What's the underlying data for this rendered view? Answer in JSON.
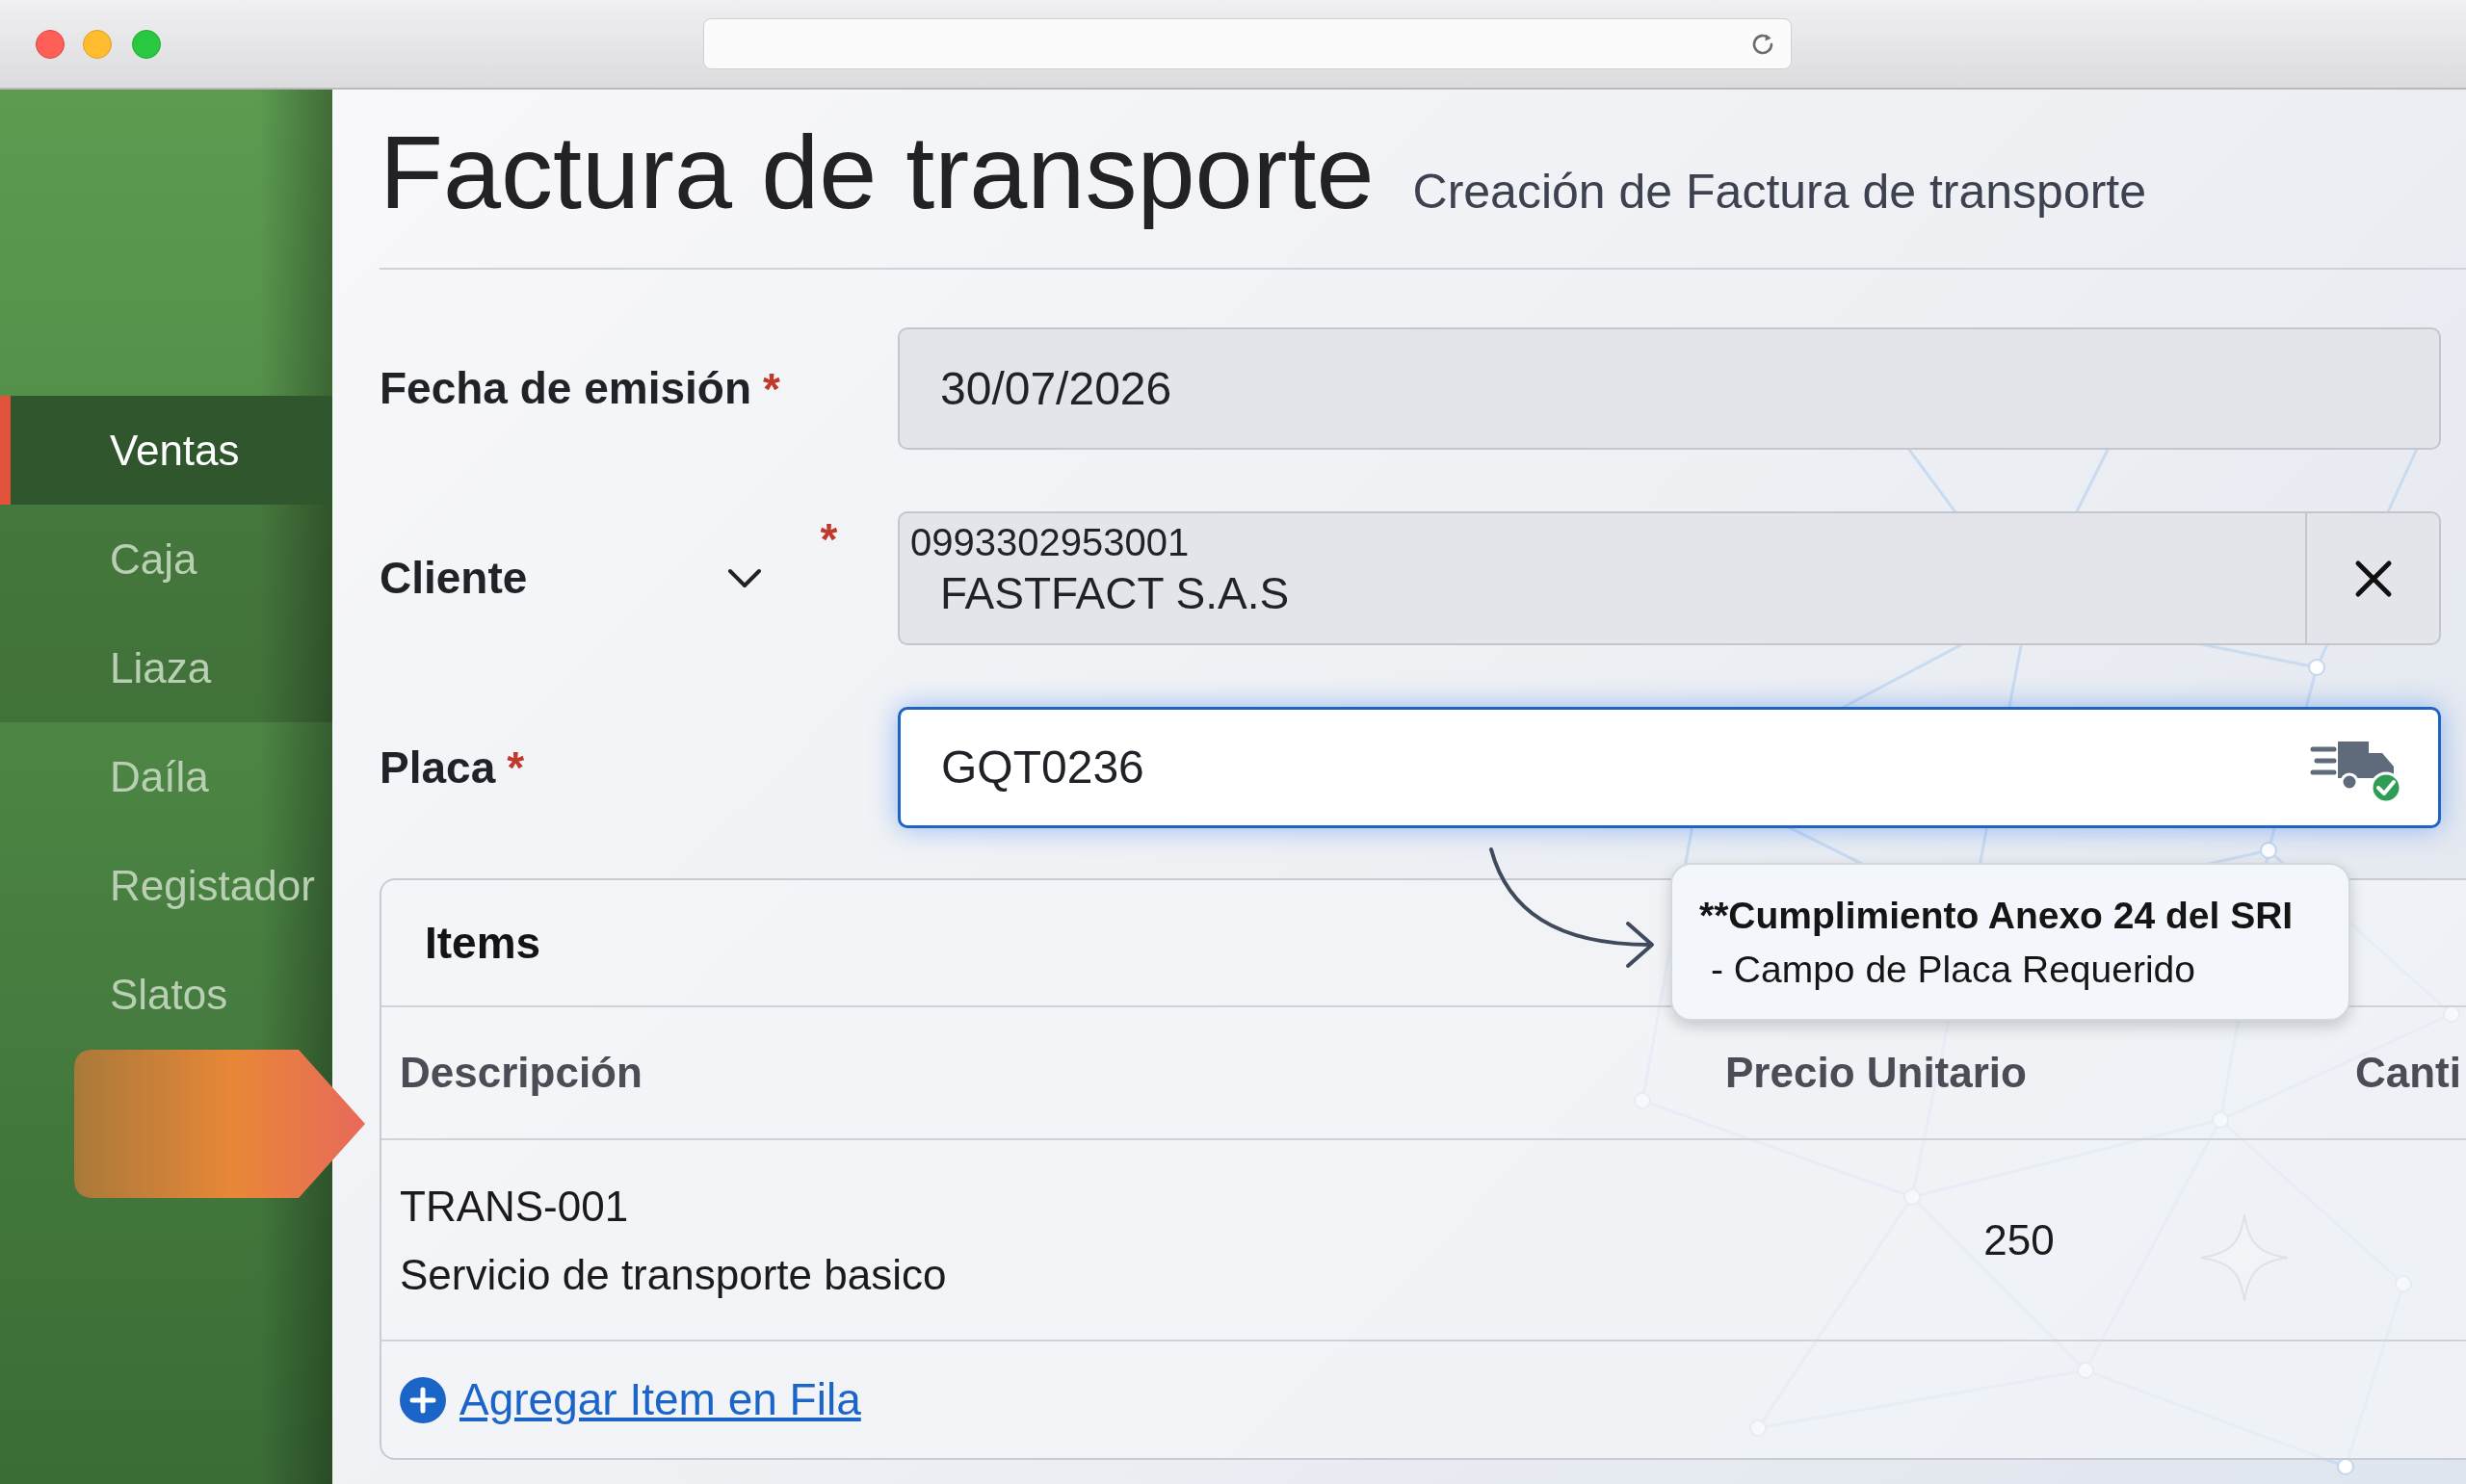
{
  "sidebar": {
    "items": [
      {
        "label": "Ventas",
        "selected": true,
        "highlighted": false
      },
      {
        "label": "Caja",
        "selected": false,
        "highlighted": true
      },
      {
        "label": "Liaza",
        "selected": false,
        "highlighted": true
      },
      {
        "label": "Daíla",
        "selected": false,
        "highlighted": false
      },
      {
        "label": "Registador",
        "selected": false,
        "highlighted": false
      },
      {
        "label": "Slatos",
        "selected": false,
        "highlighted": false
      }
    ]
  },
  "header": {
    "title": "Factura de transporte",
    "subtitle": "Creación de Factura de transporte"
  },
  "form": {
    "fields": [
      {
        "kind": "date",
        "label": "Fecha de emisión",
        "required_mark": "*",
        "value": "30/07/2026",
        "focused": false
      },
      {
        "kind": "select",
        "label": "Cliente",
        "required_mark": "*",
        "code": "0993302953001",
        "value": "FASTFACT S.A.S",
        "focused": false
      },
      {
        "kind": "plate",
        "label": "Placa",
        "required_mark": "*",
        "value": "GQT0236",
        "focused": true
      }
    ]
  },
  "callout": {
    "title": "**Cumplimiento Anexo 24 del SRI",
    "text": "- Campo de Placa Requerido"
  },
  "items_table": {
    "title": "Items",
    "columns": [
      "Descripción",
      "Precio Unitario",
      "Canti"
    ],
    "rows": [
      {
        "code": "TRANS-001",
        "description": "Servicio de transporte basico",
        "unit_price": "250"
      }
    ],
    "add_link": "Agregar Item en Fila"
  }
}
